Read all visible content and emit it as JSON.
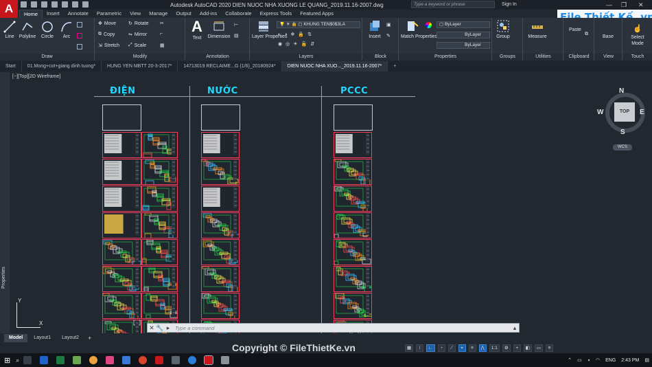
{
  "app": {
    "logo": "A",
    "window_title": "Autodesk AutoCAD 2020    DIEN NUOC NHA XUONG LE QUANG_2019.11.16-2007.dwg",
    "search_placeholder": "Type a keyword or phrase",
    "sign_in": "Sign In"
  },
  "ribbon_tabs": [
    "Home",
    "Insert",
    "Annotate",
    "Parametric",
    "View",
    "Manage",
    "Output",
    "Add-ins",
    "Collaborate",
    "Express Tools",
    "Featured Apps"
  ],
  "ribbon": {
    "draw": {
      "title": "Draw",
      "line": "Line",
      "polyline": "Polyline",
      "circle": "Circle",
      "arc": "Arc"
    },
    "modify": {
      "title": "Modify",
      "move": "Move",
      "rotate": "Rotate",
      "copy": "Copy",
      "mirror": "Mirror",
      "stretch": "Stretch",
      "scale": "Scale"
    },
    "annotation": {
      "title": "Annotation",
      "text": "Text",
      "dimension": "Dimension"
    },
    "layers": {
      "title": "Layers",
      "layer_properties": "Layer Properties",
      "current_layer": "KHUNG TEN$0$3LA"
    },
    "block": {
      "title": "Block",
      "insert": "Insert"
    },
    "properties": {
      "title": "Properties",
      "match": "Match Properties",
      "color": "ByLayer",
      "linetype": "ByLayer",
      "lineweight": "ByLayer"
    },
    "groups": {
      "title": "Groups",
      "group": "Group"
    },
    "utilities": {
      "title": "Utilities",
      "measure": "Measure"
    },
    "clipboard": {
      "title": "Clipboard",
      "paste": "Paste"
    },
    "view": {
      "title": "View",
      "base": "Base"
    },
    "touch": {
      "title": "Touch",
      "select_mode": "Select Mode"
    }
  },
  "file_tabs": [
    {
      "label": "Start",
      "active": false
    },
    {
      "label": "01.Mong+cot+giang dinh tuong*",
      "active": false
    },
    {
      "label": "HUNG YEN MBTT 20-3-2017*",
      "active": false
    },
    {
      "label": "14713019 RECLAIME...G (1/6)_20180924*",
      "active": false
    },
    {
      "label": "DIEN NUOC NHA XUO..._2019.11.16-2007*",
      "active": true
    }
  ],
  "viewport_label": "[−][Top][2D Wireframe]",
  "sidebar_label": "Properties",
  "sections": [
    {
      "title": "ĐIỆN"
    },
    {
      "title": "NƯỚC"
    },
    {
      "title": "PCCC"
    }
  ],
  "viewcube": {
    "top": "TOP",
    "n": "N",
    "s": "S",
    "e": "E",
    "w": "W",
    "wcs": "WCS"
  },
  "ucs": {
    "x": "X",
    "y": "Y"
  },
  "command_placeholder": "Type a command",
  "layout_tabs": [
    {
      "label": "Model",
      "active": true
    },
    {
      "label": "Layout1",
      "active": false
    },
    {
      "label": "Layout2",
      "active": false
    }
  ],
  "status": {
    "scale": "1:1"
  },
  "watermark": "Copyright © FileThietKe.vn",
  "brand": "File Thiết Kế .vn",
  "taskbar": {
    "lang": "ENG",
    "time": "2:43 PM"
  },
  "colors": {
    "accent": "#23d8ff",
    "sheet_border": "#ff3b5c",
    "autocad_red": "#c5171c"
  }
}
